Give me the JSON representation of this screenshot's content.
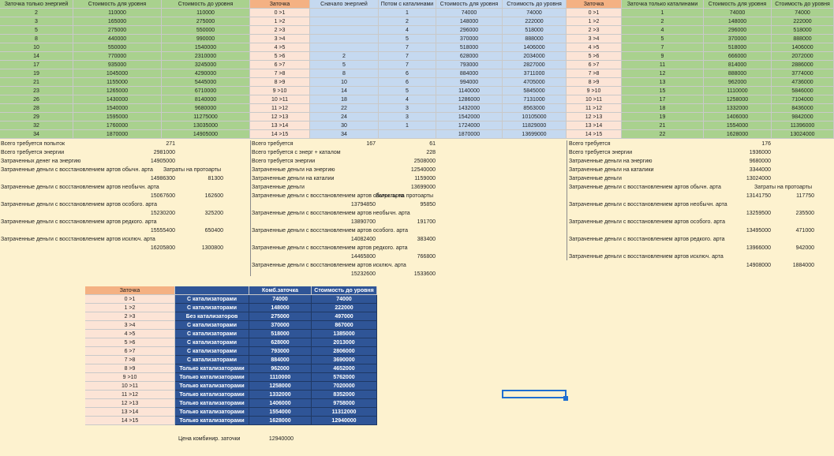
{
  "block1": {
    "headers": [
      "Заточка только энергией",
      "Стоимость для уровня",
      "Стоимость до уровня"
    ],
    "rows": [
      [
        "2",
        "110000",
        "110000"
      ],
      [
        "3",
        "165000",
        "275000"
      ],
      [
        "5",
        "275000",
        "550000"
      ],
      [
        "8",
        "440000",
        "990000"
      ],
      [
        "10",
        "550000",
        "1540000"
      ],
      [
        "14",
        "770000",
        "2310000"
      ],
      [
        "17",
        "935000",
        "3245000"
      ],
      [
        "19",
        "1045000",
        "4290000"
      ],
      [
        "21",
        "1155000",
        "5445000"
      ],
      [
        "23",
        "1265000",
        "6710000"
      ],
      [
        "26",
        "1430000",
        "8140000"
      ],
      [
        "28",
        "1540000",
        "9680000"
      ],
      [
        "29",
        "1595000",
        "11275000"
      ],
      [
        "32",
        "1760000",
        "13035000"
      ],
      [
        "34",
        "1870000",
        "14905000"
      ]
    ],
    "summary": [
      {
        "label": "Всего требуется попыток",
        "v1": "271",
        "v2": ""
      },
      {
        "label": "Всего требуется энергии",
        "v1": "2981000",
        "v2": ""
      },
      {
        "label": "Затраченных денег на энергию",
        "v1": "14905000",
        "v2": ""
      },
      {
        "label": "Затраченные деньги с восстановлением артов обычн. арта",
        "v1": "",
        "v2": "Затраты на протоарты"
      },
      {
        "label": "",
        "v1": "14986300",
        "v2": "81300"
      },
      {
        "label": "Затраченные деньги с восстановлением артов необычн. арта",
        "v1": "",
        "v2": ""
      },
      {
        "label": "",
        "v1": "15067600",
        "v2": "162600"
      },
      {
        "label": "Затраченные деньги с восстановлением артов особого. арта",
        "v1": "",
        "v2": ""
      },
      {
        "label": "",
        "v1": "15230200",
        "v2": "325200"
      },
      {
        "label": "Затраченные деньги с восстановлением артов редкого. арта",
        "v1": "",
        "v2": ""
      },
      {
        "label": "",
        "v1": "15555400",
        "v2": "650400"
      },
      {
        "label": "Затраченные деньги с восстановлением артов исключ. арта",
        "v1": "",
        "v2": ""
      },
      {
        "label": "",
        "v1": "16205800",
        "v2": "1300800"
      }
    ]
  },
  "block2": {
    "headers": [
      "Заточка",
      "Сначало энергией",
      "Потом с каталинами",
      "Стоимость для уровня",
      "Стоимость до уровня"
    ],
    "rows": [
      [
        "0 >1",
        "",
        "1",
        "74000",
        "74000"
      ],
      [
        "1 >2",
        "",
        "2",
        "148000",
        "222000"
      ],
      [
        "2 >3",
        "",
        "4",
        "296000",
        "518000"
      ],
      [
        "3 >4",
        "",
        "5",
        "370000",
        "888000"
      ],
      [
        "4 >5",
        "",
        "7",
        "518000",
        "1406000"
      ],
      [
        "5 >6",
        "2",
        "7",
        "628000",
        "2034000"
      ],
      [
        "6 >7",
        "5",
        "7",
        "793000",
        "2827000"
      ],
      [
        "7 >8",
        "8",
        "6",
        "884000",
        "3711000"
      ],
      [
        "8 >9",
        "10",
        "6",
        "994000",
        "4705000"
      ],
      [
        "9 >10",
        "14",
        "5",
        "1140000",
        "5845000"
      ],
      [
        "10 >11",
        "18",
        "4",
        "1286000",
        "7131000"
      ],
      [
        "11 >12",
        "22",
        "3",
        "1432000",
        "8563000"
      ],
      [
        "12 >13",
        "24",
        "3",
        "1542000",
        "10105000"
      ],
      [
        "13 >14",
        "30",
        "1",
        "1724000",
        "11829000"
      ],
      [
        "14 >15",
        "34",
        "",
        "1870000",
        "13699000"
      ]
    ],
    "summary": [
      {
        "label": "Всего требуется",
        "v1": "167",
        "v2": "61"
      },
      {
        "label": "Всего требуется с энерг + каталом",
        "v1": "",
        "v2": "228"
      },
      {
        "label": "Всего требуется энергии",
        "v1": "",
        "v2": "2508000"
      },
      {
        "label": "Затраченные деньги на энергию",
        "v1": "",
        "v2": "12540000"
      },
      {
        "label": "Затраченные деньги на каталии",
        "v1": "",
        "v2": "1159000"
      },
      {
        "label": "Затраченные деньги",
        "v1": "",
        "v2": "13699000"
      },
      {
        "label": "Затраченные деньги с восстановлением артов обычн. арта",
        "v1": "",
        "v2": "Затраты на протоарты"
      },
      {
        "label": "",
        "v1": "13794850",
        "v2": "95850"
      },
      {
        "label": "Затраченные деньги с восстановлением артов необычн. арта",
        "v1": "",
        "v2": ""
      },
      {
        "label": "",
        "v1": "13890700",
        "v2": "191700"
      },
      {
        "label": "Затраченные деньги с восстановлением артов особого. арта",
        "v1": "",
        "v2": ""
      },
      {
        "label": "",
        "v1": "14082400",
        "v2": "383400"
      },
      {
        "label": "Затраченные деньги с восстановлением артов редкого. арта",
        "v1": "",
        "v2": ""
      },
      {
        "label": "",
        "v1": "14465800",
        "v2": "766800"
      },
      {
        "label": "Затраченные деньги с восстановлением артов исключ. арта",
        "v1": "",
        "v2": ""
      },
      {
        "label": "",
        "v1": "15232600",
        "v2": "1533600"
      }
    ]
  },
  "block3": {
    "headers": [
      "Заточка",
      "Заточка только каталинами",
      "Стоимость для уровня",
      "Стоимость до уровня"
    ],
    "rows": [
      [
        "0 >1",
        "1",
        "74000",
        "74000"
      ],
      [
        "1 >2",
        "2",
        "148000",
        "222000"
      ],
      [
        "2 >3",
        "4",
        "296000",
        "518000"
      ],
      [
        "3 >4",
        "5",
        "370000",
        "888000"
      ],
      [
        "4 >5",
        "7",
        "518000",
        "1406000"
      ],
      [
        "5 >6",
        "9",
        "666000",
        "2072000"
      ],
      [
        "6 >7",
        "11",
        "814000",
        "2886000"
      ],
      [
        "7 >8",
        "12",
        "888000",
        "3774000"
      ],
      [
        "8 >9",
        "13",
        "962000",
        "4736000"
      ],
      [
        "9 >10",
        "15",
        "1110000",
        "5846000"
      ],
      [
        "10 >11",
        "17",
        "1258000",
        "7104000"
      ],
      [
        "11 >12",
        "18",
        "1332000",
        "8436000"
      ],
      [
        "12 >13",
        "19",
        "1406000",
        "9842000"
      ],
      [
        "13 >14",
        "21",
        "1554000",
        "11396000"
      ],
      [
        "14 >15",
        "22",
        "1628000",
        "13024000"
      ]
    ],
    "summary": [
      {
        "label": "Всего требуется",
        "v1": "176",
        "v2": ""
      },
      {
        "label": "Всего требуется энергии",
        "v1": "1936000",
        "v2": ""
      },
      {
        "label": "Затраченные деньги на энергию",
        "v1": "9680000",
        "v2": ""
      },
      {
        "label": "Затраченные деньги на каталики",
        "v1": "3344000",
        "v2": ""
      },
      {
        "label": "Затраченные деньги",
        "v1": "13024000",
        "v2": ""
      },
      {
        "label": "Затраченные деньги с восстановлением артов обычн. арта",
        "v1": "",
        "v2": "Затраты на протоарты"
      },
      {
        "label": "",
        "v1": "13141750",
        "v2": "117750"
      },
      {
        "label": "Затраченные деньги с восстановлением артов необычн. арта",
        "v1": "",
        "v2": ""
      },
      {
        "label": "",
        "v1": "13259500",
        "v2": "235500"
      },
      {
        "label": "Затраченные деньги с восстановлением артов особого. арта",
        "v1": "",
        "v2": ""
      },
      {
        "label": "",
        "v1": "13495000",
        "v2": "471000"
      },
      {
        "label": "Затраченные деньги с восстановлением артов редкого. арта",
        "v1": "",
        "v2": ""
      },
      {
        "label": "",
        "v1": "13966000",
        "v2": "942000"
      },
      {
        "label": "Затраченные деньги с восстановлением артов исключ. арта",
        "v1": "",
        "v2": ""
      },
      {
        "label": "",
        "v1": "14908000",
        "v2": "1884000"
      }
    ]
  },
  "combo": {
    "headers": [
      "Заточка",
      "",
      "Комб.заточка",
      "Стоимость до уровня"
    ],
    "rows": [
      [
        "0 >1",
        "С катализаторами",
        "74000",
        "74000"
      ],
      [
        "1 >2",
        "С катализаторами",
        "148000",
        "222000"
      ],
      [
        "2 >3",
        "Без катализаторов",
        "275000",
        "497000"
      ],
      [
        "3 >4",
        "С катализаторами",
        "370000",
        "867000"
      ],
      [
        "4 >5",
        "С катализаторами",
        "518000",
        "1385000"
      ],
      [
        "5 >6",
        "С катализаторами",
        "628000",
        "2013000"
      ],
      [
        "6 >7",
        "С катализаторами",
        "793000",
        "2806000"
      ],
      [
        "7 >8",
        "С катализаторами",
        "884000",
        "3690000"
      ],
      [
        "8 >9",
        "Только катализаторами",
        "962000",
        "4652000"
      ],
      [
        "9 >10",
        "Только катализаторами",
        "1110000",
        "5762000"
      ],
      [
        "10 >11",
        "Только катализаторами",
        "1258000",
        "7020000"
      ],
      [
        "11 >12",
        "Только катализаторами",
        "1332000",
        "8352000"
      ],
      [
        "12 >13",
        "Только катализаторами",
        "1406000",
        "9758000"
      ],
      [
        "13 >14",
        "Только катализаторами",
        "1554000",
        "11312000"
      ],
      [
        "14 >15",
        "Только катализаторами",
        "1628000",
        "12940000"
      ]
    ],
    "price_label": "Цена комбинир. заточки",
    "price_value": "12940000"
  },
  "colors": {
    "green": "#a9d18e",
    "peach": "#fce4d6",
    "orange": "#f4b183",
    "blue": "#c5d9f0",
    "navy": "#2f5597",
    "bg": "#fdf2cf"
  }
}
